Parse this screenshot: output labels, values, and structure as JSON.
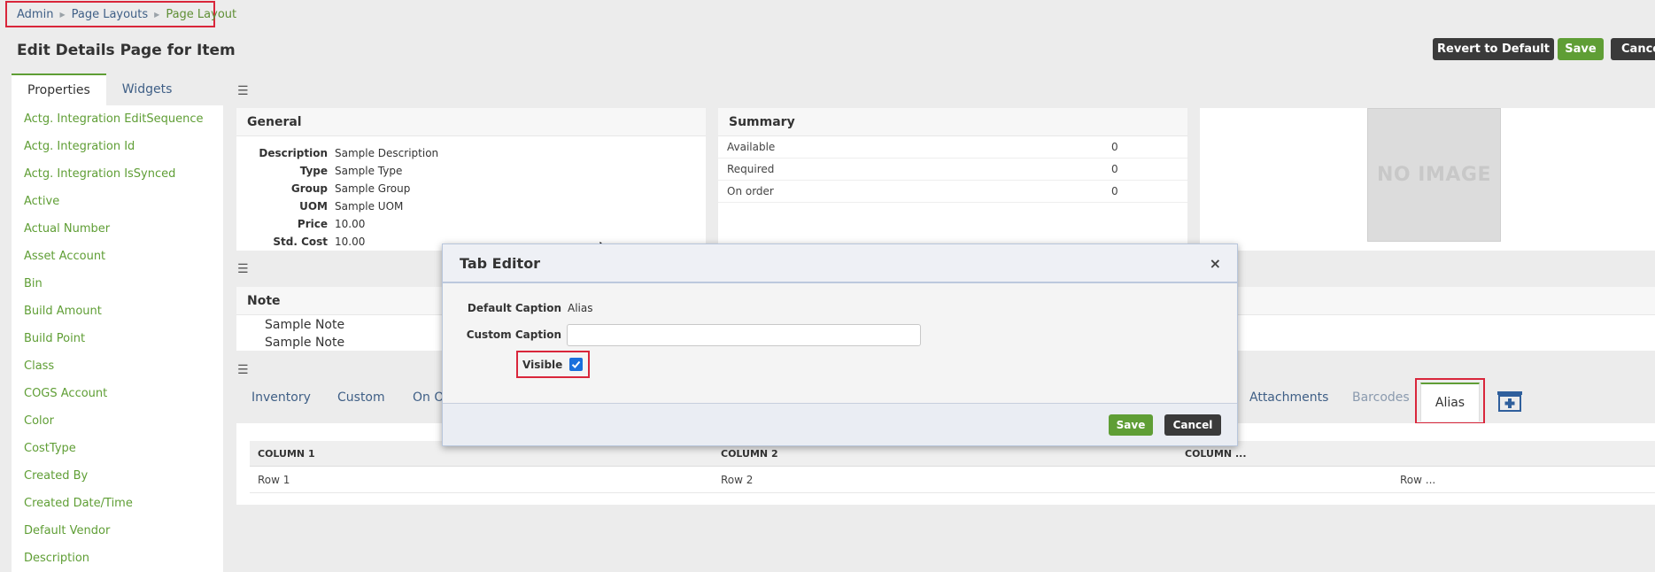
{
  "breadcrumb": {
    "items": [
      "Admin",
      "Page Layouts",
      "Page Layout"
    ]
  },
  "page_title": "Edit Details Page for Item",
  "toolbar": {
    "revert_label": "Revert to Default",
    "save_label": "Save",
    "cancel_label": "Cancel"
  },
  "left_tabs": [
    "Properties",
    "Widgets"
  ],
  "properties": [
    "Actg. Integration EditSequence",
    "Actg. Integration Id",
    "Actg. Integration IsSynced",
    "Active",
    "Actual Number",
    "Asset Account",
    "Bin",
    "Build Amount",
    "Build Point",
    "Class",
    "COGS Account",
    "Color",
    "CostType",
    "Created By",
    "Created Date/Time",
    "Default Vendor",
    "Description"
  ],
  "general": {
    "title": "General",
    "fields": [
      {
        "label": "Description",
        "value": "Sample Description"
      },
      {
        "label": "Type",
        "value": "Sample Type"
      },
      {
        "label": "Group",
        "value": "Sample Group"
      },
      {
        "label": "UOM",
        "value": "Sample UOM"
      },
      {
        "label": "Price",
        "value": "10.00"
      },
      {
        "label": "Std. Cost",
        "value": "10.00"
      }
    ]
  },
  "summary": {
    "title": "Summary",
    "rows": [
      {
        "label": "Available",
        "value": "0"
      },
      {
        "label": "Required",
        "value": "0"
      },
      {
        "label": "On order",
        "value": "0"
      }
    ]
  },
  "image": {
    "placeholder": "NO IMAGE"
  },
  "note": {
    "title": "Note",
    "lines": [
      "Sample Note",
      "Sample Note"
    ]
  },
  "bottom_tabs": {
    "left": [
      "Inventory",
      "Custom",
      "On O"
    ],
    "right": [
      "Attachments",
      "Barcodes"
    ],
    "active": "Alias"
  },
  "grid": {
    "headers": [
      "COLUMN 1",
      "COLUMN 2",
      "COLUMN ..."
    ],
    "row": [
      "Row 1",
      "Row 2",
      "Row ..."
    ]
  },
  "modal": {
    "title": "Tab Editor",
    "close_glyph": "×",
    "default_caption_label": "Default Caption",
    "default_caption_value": "Alias",
    "custom_caption_label": "Custom Caption",
    "custom_caption_value": "",
    "visible_label": "Visible",
    "visible_checked": true,
    "save_label": "Save",
    "cancel_label": "Cancel"
  },
  "colors": {
    "accent_green": "#5f9e35",
    "dark_button": "#3a3a3a",
    "link_blue": "#3f5f86",
    "highlight_red": "#d9263b"
  }
}
